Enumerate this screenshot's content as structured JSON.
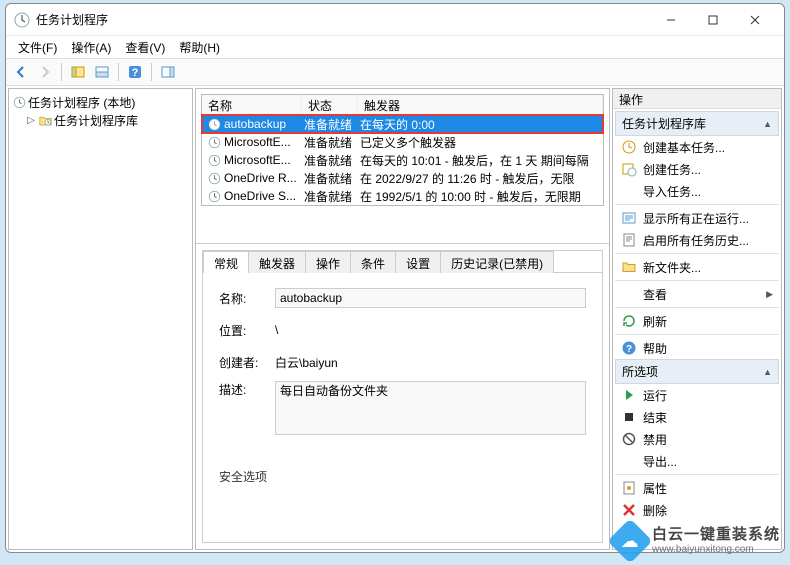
{
  "window": {
    "title": "任务计划程序"
  },
  "menu": {
    "file": "文件(F)",
    "action": "操作(A)",
    "view": "查看(V)",
    "help": "帮助(H)"
  },
  "tree": {
    "root": "任务计划程序 (本地)",
    "library": "任务计划程序库"
  },
  "task_table": {
    "headers": {
      "name": "名称",
      "status": "状态",
      "trigger": "触发器"
    },
    "rows": [
      {
        "name": "autobackup",
        "status": "准备就绪",
        "trigger": "在每天的 0:00",
        "selected": true
      },
      {
        "name": "MicrosoftE...",
        "status": "准备就绪",
        "trigger": "已定义多个触发器"
      },
      {
        "name": "MicrosoftE...",
        "status": "准备就绪",
        "trigger": "在每天的 10:01 - 触发后，在 1 天 期间每隔"
      },
      {
        "name": "OneDrive R...",
        "status": "准备就绪",
        "trigger": "在 2022/9/27 的 11:26 时 - 触发后，无限"
      },
      {
        "name": "OneDrive S...",
        "status": "准备就绪",
        "trigger": "在 1992/5/1 的 10:00 时 - 触发后，无限期"
      }
    ]
  },
  "tabs": {
    "general": "常规",
    "triggers": "触发器",
    "actions": "操作",
    "conditions": "条件",
    "settings": "设置",
    "history": "历史记录(已禁用)"
  },
  "general_form": {
    "name_label": "名称:",
    "name_value": "autobackup",
    "location_label": "位置:",
    "location_value": "\\",
    "author_label": "创建者:",
    "author_value": "白云\\baiyun",
    "desc_label": "描述:",
    "desc_value": "每日自动备份文件夹",
    "security_label": "安全选项"
  },
  "actions_panel": {
    "title": "操作",
    "group1_header": "任务计划程序库",
    "group1": [
      "创建基本任务...",
      "创建任务...",
      "导入任务...",
      "显示所有正在运行...",
      "启用所有任务历史...",
      "新文件夹...",
      "查看",
      "刷新",
      "帮助"
    ],
    "group2_header": "所选项",
    "group2": [
      "运行",
      "结束",
      "禁用",
      "导出...",
      "属性",
      "删除"
    ]
  },
  "watermark": {
    "cn": "白云一键重装系统",
    "url": "www.baiyunxitong.com"
  }
}
